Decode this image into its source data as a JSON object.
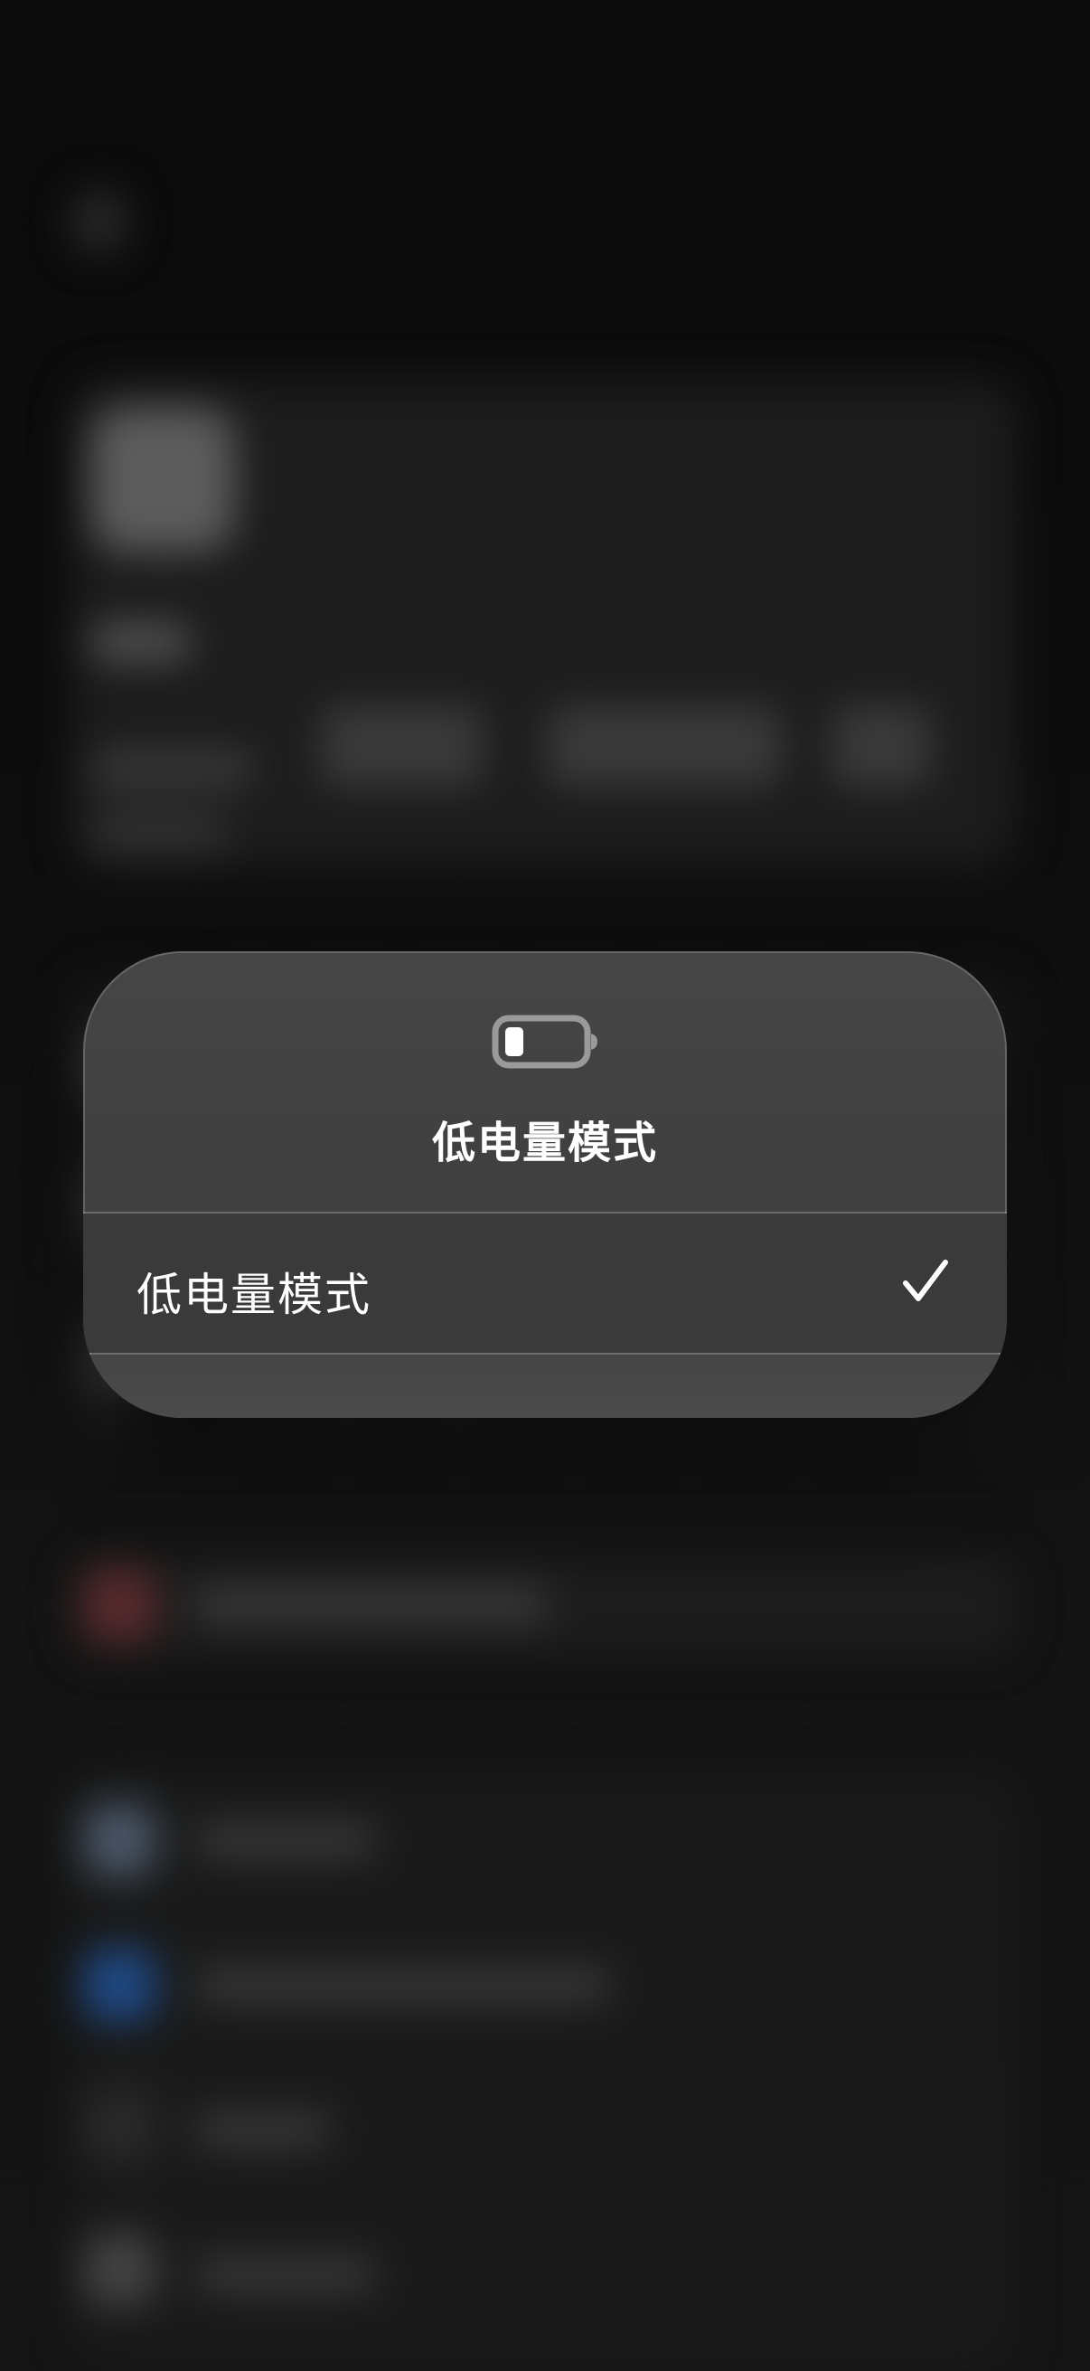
{
  "menu": {
    "header_icon": "battery-low-icon",
    "title": "低电量模式",
    "options": [
      {
        "label": "低电量模式",
        "selected": true,
        "selected_icon": "checkmark-icon"
      }
    ]
  },
  "colors": {
    "background": "#0a0a0a",
    "popup_background": "#434343",
    "selected_row": "#3a3a3b",
    "text": "#ffffff",
    "battery_outline": "#9a9a9a",
    "battery_fill": "#ffffff"
  }
}
